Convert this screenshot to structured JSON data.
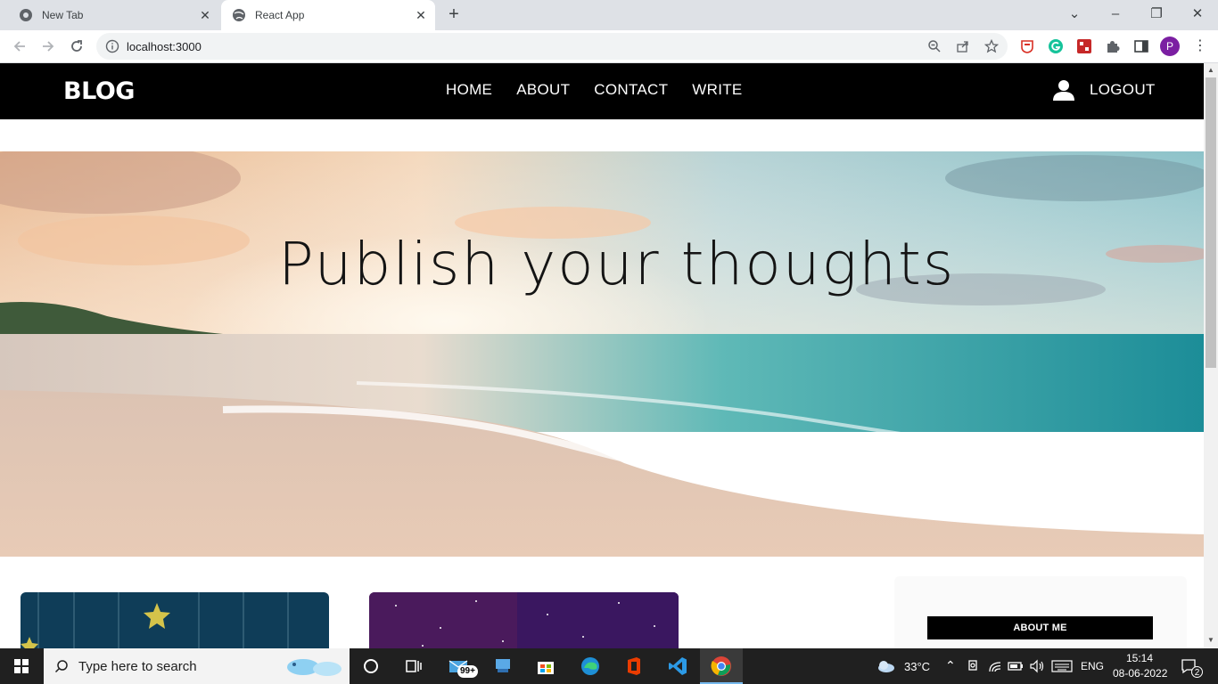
{
  "browser": {
    "tabs": [
      {
        "title": "New Tab"
      },
      {
        "title": "React App"
      }
    ],
    "url": "localhost:3000",
    "profile_initial": "P"
  },
  "site": {
    "logo": "BLOG",
    "nav": [
      "HOME",
      "ABOUT",
      "CONTACT",
      "WRITE"
    ],
    "logout": "LOGOUT",
    "hero_title": "Publish your thoughts",
    "sidebar": {
      "about_title": "ABOUT ME"
    }
  },
  "taskbar": {
    "search_placeholder": "Type here to search",
    "mail_badge": "99+",
    "weather": "33°C",
    "language": "ENG",
    "time": "15:14",
    "date": "08-06-2022",
    "notifications": "2"
  },
  "colors": {
    "topbar": "#000000",
    "taskbar": "#202020",
    "profile": "#7b1fa2"
  }
}
